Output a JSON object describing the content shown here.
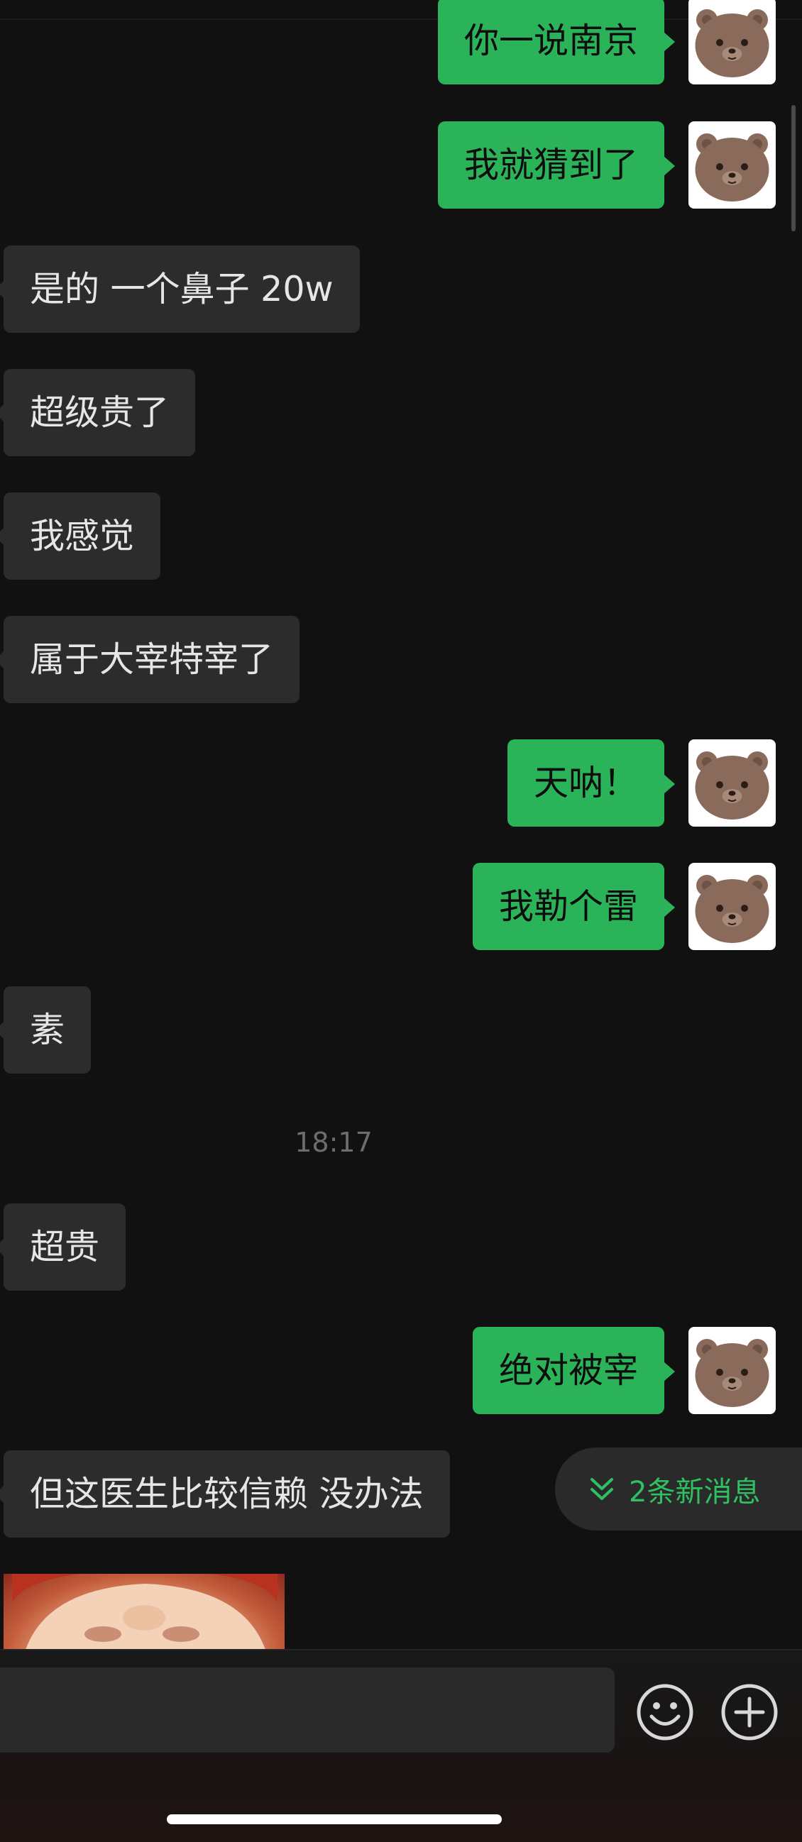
{
  "chat": {
    "messages": [
      {
        "direction": "out",
        "text": "你一说南京"
      },
      {
        "direction": "out",
        "text": "我就猜到了"
      },
      {
        "direction": "in",
        "text": "是的 一个鼻子 20w"
      },
      {
        "direction": "in",
        "text": "超级贵了"
      },
      {
        "direction": "in",
        "text": "我感觉"
      },
      {
        "direction": "in",
        "text": "属于大宰特宰了"
      },
      {
        "direction": "out",
        "text": "天呐！"
      },
      {
        "direction": "out",
        "text": "我勒个雷"
      },
      {
        "direction": "in",
        "text": "素"
      },
      {
        "direction": "in",
        "text": "超贵"
      },
      {
        "direction": "out",
        "text": "绝对被宰"
      },
      {
        "direction": "in",
        "text": "但这医生比较信赖 没办法"
      }
    ],
    "timestamp": "18:17",
    "new_messages_label": "2条新消息"
  },
  "input": {
    "value": "",
    "placeholder": ""
  },
  "icons": {
    "avatar": "bear-avatar-icon",
    "new_messages": "double-chevron-down-icon",
    "emoji": "smiley-icon",
    "more": "plus-circle-icon"
  },
  "colors": {
    "background": "#111111",
    "incoming_bubble": "#2c2c2c",
    "outgoing_bubble": "#2bb35a",
    "accent_green": "#2fc061",
    "timestamp_text": "#6d6d6d"
  }
}
